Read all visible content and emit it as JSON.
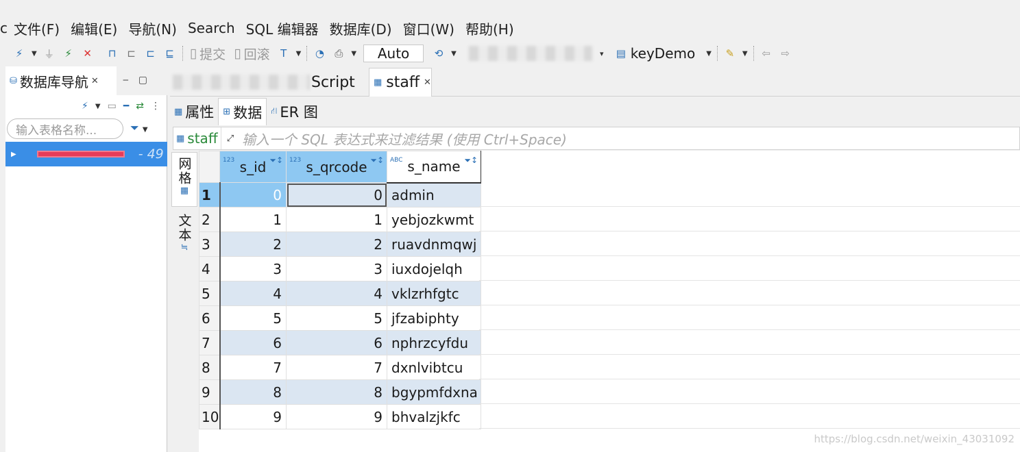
{
  "menu": {
    "edge_char": "c",
    "items": [
      "文件(F)",
      "编辑(E)",
      "导航(N)",
      "Search",
      "SQL 编辑器",
      "数据库(D)",
      "窗口(W)",
      "帮助(H)"
    ]
  },
  "toolbar": {
    "commit_label": "提交",
    "rollback_label": "回滚",
    "transaction_mode": "Auto",
    "schema_label": "keyDemo"
  },
  "navigator": {
    "title": "数据库导航",
    "search_placeholder": "输入表格名称...",
    "tree_suffix": "- 49"
  },
  "editor": {
    "script_tab_label": "Script",
    "table_tab_label": "staff",
    "subtabs": [
      "属性",
      "数据",
      "ER 图"
    ],
    "filter_table_name": "staff",
    "filter_hint": "输入一个 SQL 表达式来过滤结果 (使用 Ctrl+Space)",
    "side_tabs": [
      "网格",
      "文本"
    ]
  },
  "table": {
    "columns": [
      {
        "name": "s_id",
        "type_badge": "123"
      },
      {
        "name": "s_qrcode",
        "type_badge": "123"
      },
      {
        "name": "s_name",
        "type_badge": "ABC"
      }
    ],
    "rows": [
      {
        "rn": "1",
        "s_id": "0",
        "s_qrcode": "0",
        "s_name": "admin"
      },
      {
        "rn": "2",
        "s_id": "1",
        "s_qrcode": "1",
        "s_name": "yebjozkwmt"
      },
      {
        "rn": "3",
        "s_id": "2",
        "s_qrcode": "2",
        "s_name": "ruavdnmqwj"
      },
      {
        "rn": "4",
        "s_id": "3",
        "s_qrcode": "3",
        "s_name": "iuxdojelqh"
      },
      {
        "rn": "5",
        "s_id": "4",
        "s_qrcode": "4",
        "s_name": "vklzrhfgtc"
      },
      {
        "rn": "6",
        "s_id": "5",
        "s_qrcode": "5",
        "s_name": "jfzabiphty"
      },
      {
        "rn": "7",
        "s_id": "6",
        "s_qrcode": "6",
        "s_name": "nphrzcyfdu"
      },
      {
        "rn": "8",
        "s_id": "7",
        "s_qrcode": "7",
        "s_name": "dxnlvibtcu"
      },
      {
        "rn": "9",
        "s_id": "8",
        "s_qrcode": "8",
        "s_name": "bgypmfdxna"
      },
      {
        "rn": "10",
        "s_id": "9",
        "s_qrcode": "9",
        "s_name": "bhvalzjkfc"
      }
    ]
  },
  "watermark": "https://blog.csdn.net/weixin_43031092"
}
